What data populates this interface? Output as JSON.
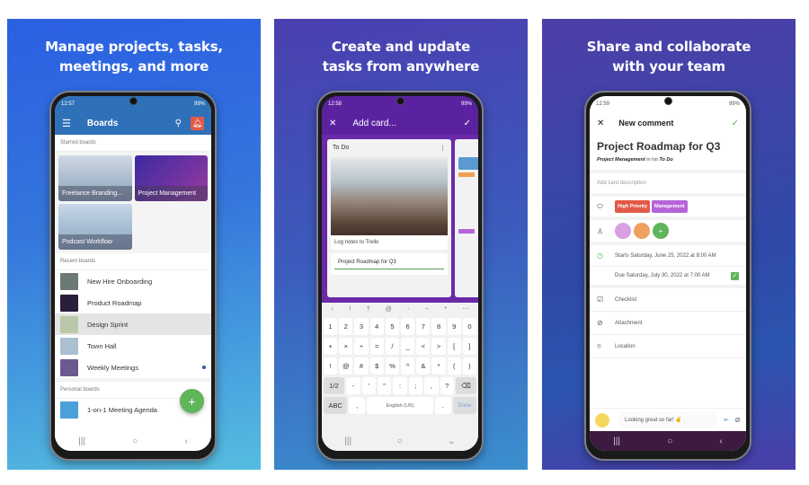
{
  "panels": [
    {
      "headline": "Manage projects, tasks, meetings, and more",
      "phone": {
        "status_time": "12:57",
        "status_right": "99%",
        "appbar": {
          "title": "Boards",
          "menu_icon": "hamburger-icon",
          "search_icon": "search-icon",
          "notification_icon": "bell-icon"
        },
        "starred_label": "Starred boards",
        "starred_boards": [
          {
            "name": "Freelance Branding...",
            "color": "#8aa0b8"
          },
          {
            "name": "Project Management",
            "color": "#5a2a90"
          },
          {
            "name": "Podcast Workflow",
            "color": "#9ab4cc"
          }
        ],
        "recent_label": "Recent boards",
        "recent_boards": [
          {
            "name": "New Hire Onboarding",
            "selected": false,
            "unread": false,
            "thumb": "#6b7a72"
          },
          {
            "name": "Product Roadmap",
            "selected": false,
            "unread": false,
            "thumb": "#2a1f3a"
          },
          {
            "name": "Design Sprint",
            "selected": true,
            "unread": false,
            "thumb": "#b8c8a8"
          },
          {
            "name": "Town Hall",
            "selected": false,
            "unread": false,
            "thumb": "#a8c0d0"
          },
          {
            "name": "Weekly Meetings",
            "selected": false,
            "unread": true,
            "thumb": "#6a5a90"
          }
        ],
        "personal_label": "Personal boards",
        "personal_boards": [
          {
            "name": "1-on-1 Meeting Agenda",
            "thumb": "#4aa0d8"
          }
        ],
        "fab_label": "+",
        "nav": [
          "|||",
          "○",
          "‹"
        ]
      }
    },
    {
      "headline": "Create and update tasks from anywhere",
      "phone": {
        "status_time": "12:58",
        "status_right": "99%",
        "appbar": {
          "close": "✕",
          "title": "Add card...",
          "confirm": "✓"
        },
        "list_title": "To Do",
        "list_menu": "⋮",
        "cards": [
          {
            "text": "Log notes to Trello"
          }
        ],
        "new_card_input": "Project Roadmap for Q3",
        "keyboard": {
          "top_row": [
            "‹",
            "!",
            "?",
            "@",
            "-",
            "~",
            "*",
            "⋯"
          ],
          "rows": [
            [
              "1",
              "2",
              "3",
              "4",
              "5",
              "6",
              "7",
              "8",
              "9",
              "0"
            ],
            [
              "+",
              "×",
              "÷",
              "=",
              "/",
              "_",
              "<",
              ">",
              "[",
              "]"
            ],
            [
              "!",
              "@",
              "#",
              "$",
              "%",
              "^",
              "&",
              "*",
              "(",
              ")"
            ],
            [
              "1/2",
              "-",
              "'",
              "\"",
              ":",
              ";",
              ",",
              "?",
              "⌫"
            ],
            [
              "ABC",
              ",",
              "English (US)",
              ".",
              "Done"
            ]
          ]
        },
        "nav": [
          "|||",
          "○",
          "⌄"
        ]
      }
    },
    {
      "headline": "Share and collaborate with your team",
      "phone": {
        "status_time": "12:59",
        "status_right": "99%",
        "appbar": {
          "close": "✕",
          "title": "New comment",
          "confirm": "✓"
        },
        "card_title": "Project Roadmap for Q3",
        "board_name": "Project Management",
        "in_list_text": "in list",
        "list_name": "To Do",
        "description_placeholder": "Add card description",
        "labels": [
          {
            "text": "High Priority",
            "color": "#e05a48"
          },
          {
            "text": "Management",
            "color": "#b565d8"
          }
        ],
        "members": [
          {
            "color": "#d8a0e0"
          },
          {
            "color": "#f0a060"
          }
        ],
        "add_member": "+",
        "start_date": "Starts Saturday, June 25, 2022 at 8:00 AM",
        "due_date": "Due Saturday, July 30, 2022 at 7:00 AM",
        "due_complete": true,
        "actions": [
          "Checklist",
          "Attachment",
          "Location"
        ],
        "comment_value": "Looking great so far! ✌",
        "nav": [
          "|||",
          "○",
          "‹"
        ]
      }
    }
  ],
  "colors": {
    "trello_blue": "#2f71b8",
    "purple": "#5b22a0",
    "green": "#5fb55a"
  }
}
